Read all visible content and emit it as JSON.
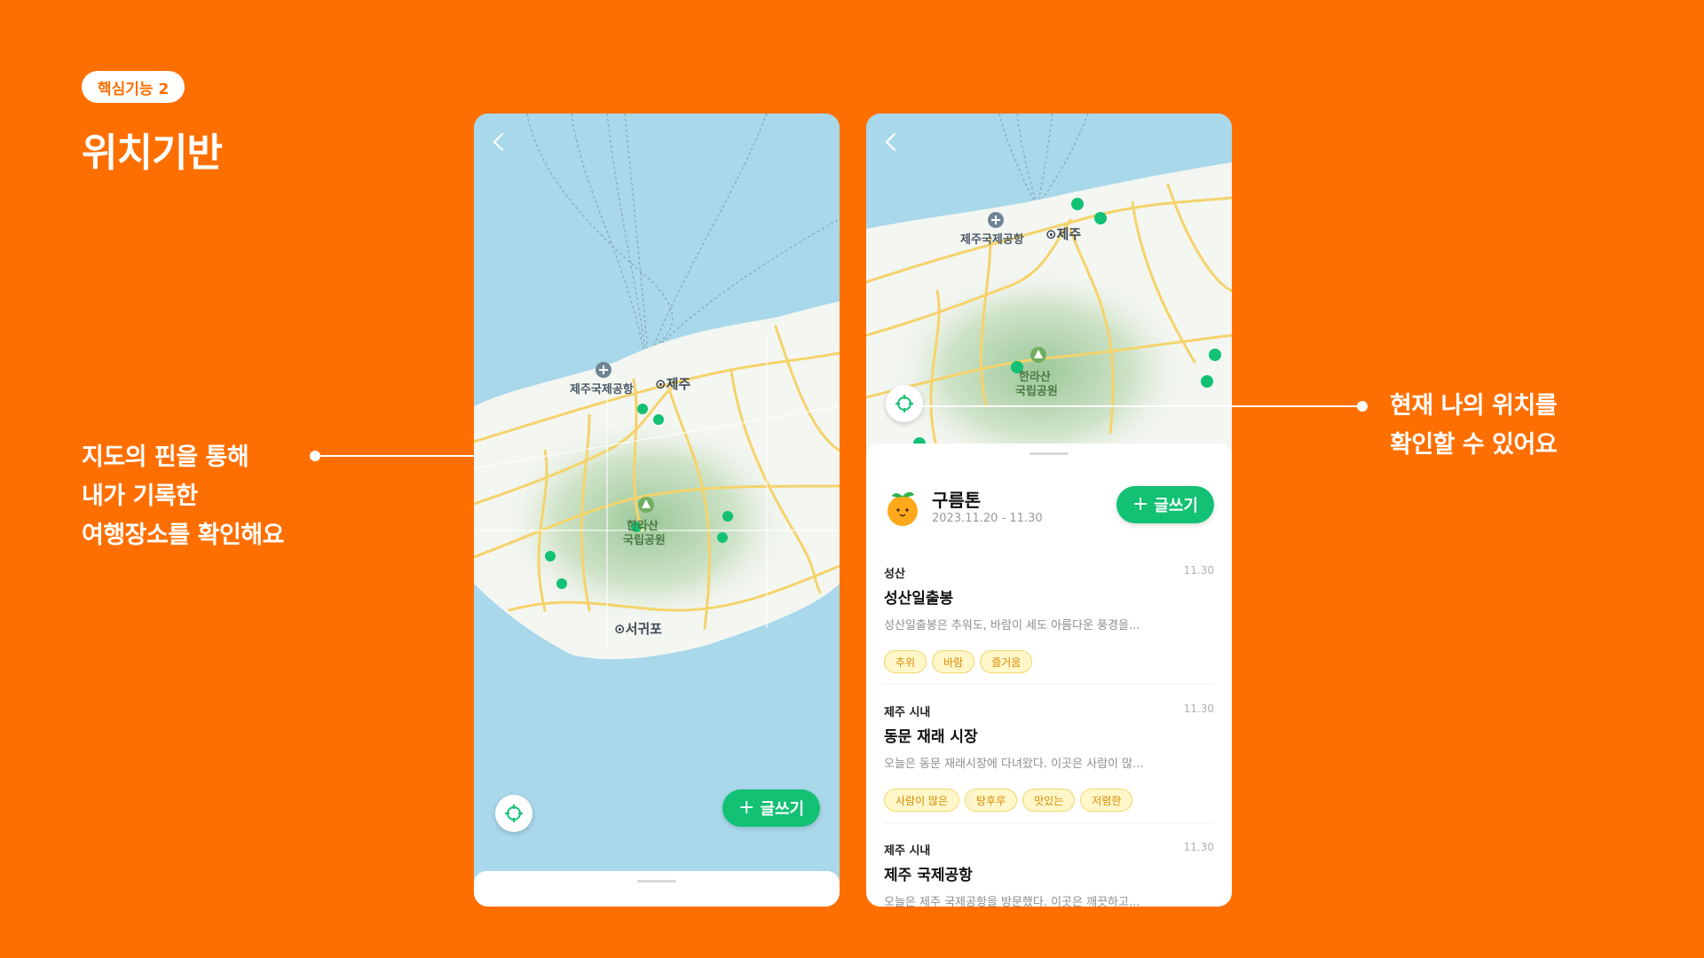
{
  "slide": {
    "badge": "핵심기능 2",
    "title": "위치기반"
  },
  "callouts": {
    "left": [
      "지도의 핀을 통해",
      "내가 기록한",
      "여행장소를 확인해요"
    ],
    "right": [
      "현재 나의 위치를",
      "확인할 수 있어요"
    ]
  },
  "map": {
    "labels": {
      "airport": "제주국제공항",
      "jeju": "⊙제주",
      "hallasan_1": "한라산",
      "hallasan_2": "국립공원",
      "seogwipo": "⊙서귀포"
    },
    "colors": {
      "sea": "#A8D8EA",
      "land": "#F4F6F2",
      "mountain": "#CFE3C8",
      "road": "#F5D36B",
      "pin": "#12C174"
    }
  },
  "phone1": {
    "write_label": "글쓰기"
  },
  "phone2": {
    "trip": {
      "name": "구름톤",
      "dates": "2023.11.20 - 11.30"
    },
    "write_label": "글쓰기",
    "entries": [
      {
        "region": "성산",
        "date": "11.30",
        "title": "성산일출봉",
        "preview": "성산일출봉은 추워도, 바람이 세도 아름다운 풍경을...",
        "tags": [
          "추위",
          "바람",
          "즐거움"
        ]
      },
      {
        "region": "제주 시내",
        "date": "11.30",
        "title": "동문 재래 시장",
        "preview": "오늘은 동문 재래시장에 다녀왔다. 이곳은 사람이 많...",
        "tags": [
          "사람이 많은",
          "탕후루",
          "맛있는",
          "저렴한"
        ]
      },
      {
        "region": "제주 시내",
        "date": "11.30",
        "title": "제주 국제공항",
        "preview": "오늘은 제주 국제공항을 방문했다. 이곳은 깨끗하고...",
        "tags": []
      }
    ]
  }
}
